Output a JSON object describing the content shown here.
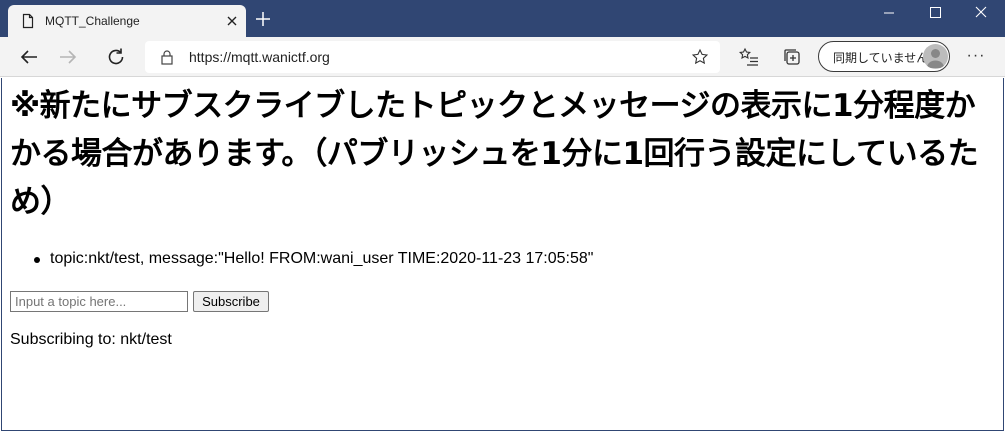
{
  "browser": {
    "tab_title": "MQTT_Challenge",
    "url": "https://mqtt.wanictf.org",
    "profile_label": "同期していません",
    "more_label": "···",
    "icons": {
      "tab": "document-icon",
      "close": "close-icon",
      "new_tab": "plus-icon",
      "back": "back-arrow-icon",
      "forward": "forward-arrow-icon",
      "reload": "reload-icon",
      "lock": "lock-icon",
      "favorite": "star-icon",
      "favorites_list": "favorites-list-icon",
      "collections": "collections-icon",
      "avatar": "avatar-icon"
    }
  },
  "page": {
    "heading": "※新たにサブスクライブしたトピックとメッセージの表示に1分程度かかる場合があります。（パブリッシュを1分に1回行う設定にしているため）",
    "messages": [
      "topic:nkt/test, message:\"Hello! FROM:wani_user TIME:2020-11-23 17:05:58\""
    ],
    "topic_input": {
      "value": "",
      "placeholder": "Input a topic here..."
    },
    "subscribe_label": "Subscribe",
    "subscribing_text": "Subscribing to: nkt/test"
  },
  "colors": {
    "titlebar": "#304673",
    "toolbar": "#f3f3f3",
    "tab": "#f3f3f3"
  }
}
